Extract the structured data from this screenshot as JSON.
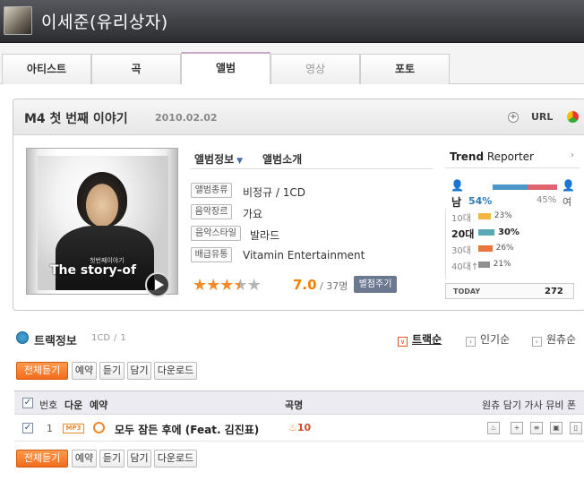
{
  "header": {
    "artist_name": "이세준(유리상자)"
  },
  "tabs": [
    {
      "label": "아티스트",
      "active": false,
      "enabled": true
    },
    {
      "label": "곡",
      "active": false,
      "enabled": true
    },
    {
      "label": "앨범",
      "active": true,
      "enabled": true
    },
    {
      "label": "영상",
      "active": false,
      "enabled": false
    },
    {
      "label": "포토",
      "active": false,
      "enabled": true
    }
  ],
  "album": {
    "title": "M4 첫 번째 이야기",
    "date": "2010.02.02",
    "url_label": "URL",
    "cover_text": "The story-of",
    "cover_subtitle": "첫번째이야기",
    "info_tabs": [
      "앨범정보",
      "앨범소개"
    ],
    "info": [
      {
        "label": "앨범종류",
        "value": "비정규 / 1CD"
      },
      {
        "label": "음악장르",
        "value": "가요"
      },
      {
        "label": "음악스타일",
        "value": "발라드"
      },
      {
        "label": "배급유통",
        "value": "Vitamin Entertainment"
      }
    ],
    "rating": {
      "score": "7.0",
      "count": "/ 37명",
      "stars": 3.5,
      "rate_button": "별점주기"
    }
  },
  "trend": {
    "title_bold": "Trend",
    "title_rest": " Reporter",
    "male_label": "남",
    "female_label": "여",
    "male_pct": "54%",
    "female_pct": "45%",
    "male_fraction": 0.54,
    "ages": [
      {
        "label": "10대",
        "pct": "23%",
        "value": 23,
        "color": "#f3b640",
        "highlight": false
      },
      {
        "label": "20대",
        "pct": "30%",
        "value": 30,
        "color": "#5aaab5",
        "highlight": true
      },
      {
        "label": "30대",
        "pct": "26%",
        "value": 26,
        "color": "#e8763c",
        "highlight": false
      },
      {
        "label": "40대↑",
        "pct": "21%",
        "value": 21,
        "color": "#909090",
        "highlight": false
      }
    ],
    "today_label": "TODAY",
    "today_value": "272"
  },
  "tracks": {
    "title": "트랙정보",
    "cd_count": "1CD",
    "cd_sep": "/",
    "track_count": "1",
    "sort_options": [
      {
        "label": "트랙순",
        "active": true,
        "glyph": "∨"
      },
      {
        "label": "인기순",
        "active": false,
        "glyph": "›"
      },
      {
        "label": "원츄순",
        "active": false,
        "glyph": "›"
      }
    ],
    "buttons": [
      "전체듣기",
      "예약",
      "듣기",
      "담기",
      "다운로드"
    ],
    "columns": {
      "num": "번호",
      "next": "다운",
      "reserve": "예약",
      "title": "곡명",
      "right": "원츄 담기 가사 뮤비 폰"
    },
    "rows": [
      {
        "num": "1",
        "badge": "MP3",
        "title": "모두 잠든 후에 (Feat. 김진표)",
        "likes": "10"
      }
    ]
  }
}
